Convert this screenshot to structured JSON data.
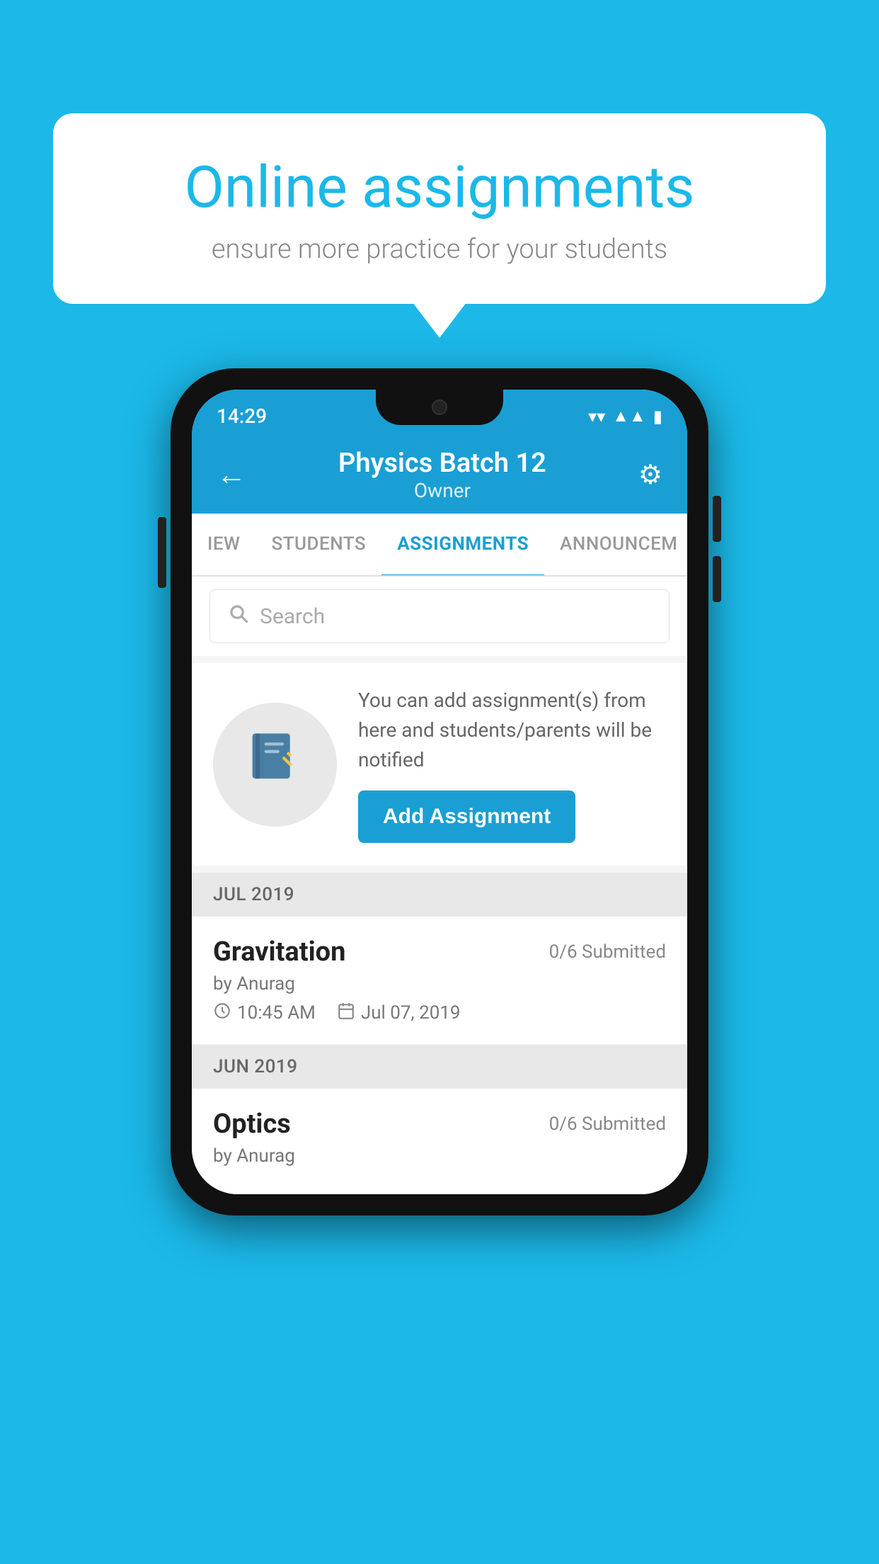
{
  "background_color": "#1bb8e8",
  "speech_bubble": {
    "heading": "Online assignments",
    "subtext": "ensure more practice for your students"
  },
  "status_bar": {
    "time": "14:29",
    "wifi": "▾",
    "signal": "▲",
    "battery": "▮"
  },
  "header": {
    "title": "Physics Batch 12",
    "subtitle": "Owner",
    "back_label": "←",
    "settings_label": "⚙"
  },
  "tabs": [
    {
      "label": "IEW",
      "active": false
    },
    {
      "label": "STUDENTS",
      "active": false
    },
    {
      "label": "ASSIGNMENTS",
      "active": true
    },
    {
      "label": "ANNOUNCEM...",
      "active": false
    }
  ],
  "search": {
    "placeholder": "Search"
  },
  "promo": {
    "description": "You can add assignment(s) from here and students/parents will be notified",
    "button_label": "Add Assignment"
  },
  "sections": [
    {
      "header": "JUL 2019",
      "assignments": [
        {
          "title": "Gravitation",
          "submitted": "0/6 Submitted",
          "author": "by Anurag",
          "time": "10:45 AM",
          "date": "Jul 07, 2019"
        }
      ]
    },
    {
      "header": "JUN 2019",
      "assignments": [
        {
          "title": "Optics",
          "submitted": "0/6 Submitted",
          "author": "by Anurag",
          "time": "",
          "date": ""
        }
      ]
    }
  ]
}
